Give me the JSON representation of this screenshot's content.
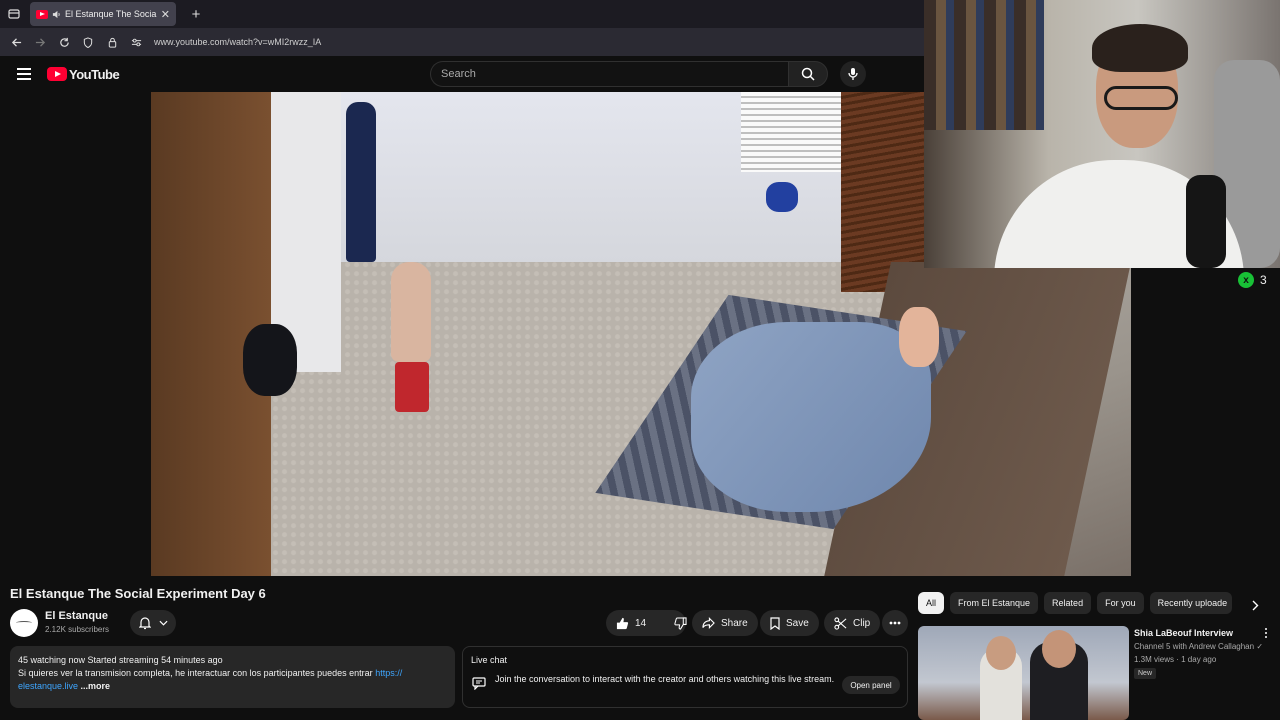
{
  "browser": {
    "tab_title": "El Estanque The Social Experi",
    "url": "www.youtube.com/watch?v=wMI2rwzz_IA"
  },
  "header": {
    "logo_text": "YouTube",
    "search_placeholder": "Search"
  },
  "video": {
    "title": "El Estanque The Social Experiment Day 6"
  },
  "overlay": {
    "viewer_count": "3",
    "viewer_icon": "x"
  },
  "channel": {
    "name": "El Estanque",
    "subscribers": "2.12K subscribers"
  },
  "actions": {
    "like_count": "14",
    "share_label": "Share",
    "save_label": "Save",
    "clip_label": "Clip"
  },
  "description": {
    "stats": "45 watching now  Started streaming 54 minutes ago",
    "text": "Si quieres ver la transmision completa, he interactuar con los participantes puedes entrar ",
    "link_part1": "https://",
    "link_part2": "elestanque.live",
    "more": " ...more"
  },
  "live_chat": {
    "heading": "Live chat",
    "message": "Join the conversation to interact with the creator and others watching this live stream.",
    "open_label": "Open panel"
  },
  "chips": [
    "All",
    "From El Estanque",
    "Related",
    "For you",
    "Recently uploade"
  ],
  "recommendation": {
    "title": "Shia LaBeouf Interview",
    "channel": "Channel 5 with Andrew Callaghan",
    "meta": "1.3M views · 1 day ago",
    "badge": "New"
  },
  "colors": {
    "background": "#0f0f0f",
    "brand_red": "#ff0033",
    "link_blue": "#3ea6ff",
    "viewer_green": "#18c036"
  }
}
